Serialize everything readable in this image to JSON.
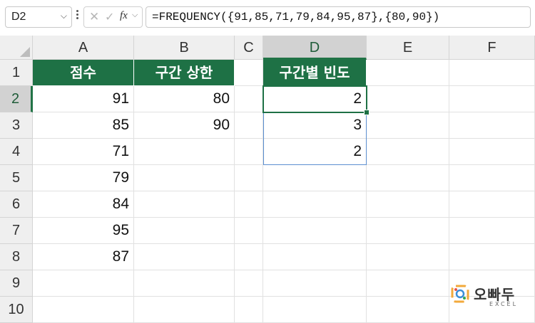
{
  "formula_bar": {
    "name_box": "D2",
    "formula": "=FREQUENCY({91,85,71,79,84,95,87},{80,90})",
    "fx_label": "fx"
  },
  "columns": [
    "A",
    "B",
    "C",
    "D",
    "E",
    "F"
  ],
  "rows": [
    "1",
    "2",
    "3",
    "4",
    "5",
    "6",
    "7",
    "8",
    "9",
    "10"
  ],
  "headers": {
    "a1": "점수",
    "b1": "구간 상한",
    "d1": "구간별 빈도"
  },
  "scores": [
    "91",
    "85",
    "71",
    "79",
    "84",
    "95",
    "87"
  ],
  "bin_upper": [
    "80",
    "90"
  ],
  "frequency": [
    "2",
    "3",
    "2"
  ],
  "watermark": {
    "text": "오빠두",
    "sub": "EXCEL"
  },
  "colors": {
    "header_fill": "#1e7145",
    "selection_border": "#5b8fd0"
  }
}
